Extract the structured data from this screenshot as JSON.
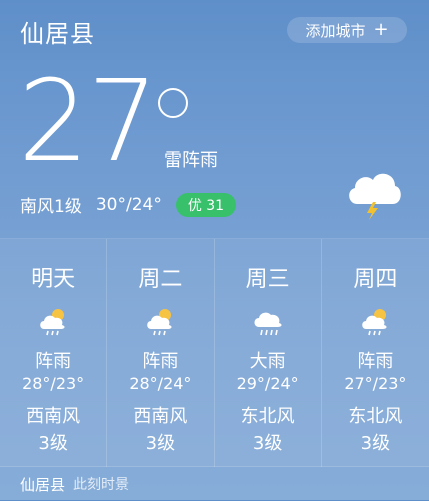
{
  "header": {
    "city": "仙居县",
    "add_city": "添加城市",
    "add_icon": "plus-icon"
  },
  "current": {
    "temperature": "27",
    "condition": "雷阵雨",
    "wind": "南风1级",
    "range": "30°/24°",
    "aqi_label": "优 31",
    "aqi_color": "#38c06b",
    "icon": "thunderstorm-cloud-icon"
  },
  "forecast": [
    {
      "day": "明天",
      "icon": "sun-cloud-rain-icon",
      "condition": "阵雨",
      "temp": "28°/23°",
      "wind": "西南风",
      "level": "3级"
    },
    {
      "day": "周二",
      "icon": "sun-cloud-rain-icon",
      "condition": "阵雨",
      "temp": "28°/24°",
      "wind": "西南风",
      "level": "3级"
    },
    {
      "day": "周三",
      "icon": "cloud-rain-icon",
      "condition": "大雨",
      "temp": "29°/24°",
      "wind": "东北风",
      "level": "3级"
    },
    {
      "day": "周四",
      "icon": "sun-cloud-rain-icon",
      "condition": "阵雨",
      "temp": "27°/23°",
      "wind": "东北风",
      "level": "3级"
    }
  ],
  "footer": {
    "city": "仙居县",
    "subtitle": "此刻时景"
  }
}
